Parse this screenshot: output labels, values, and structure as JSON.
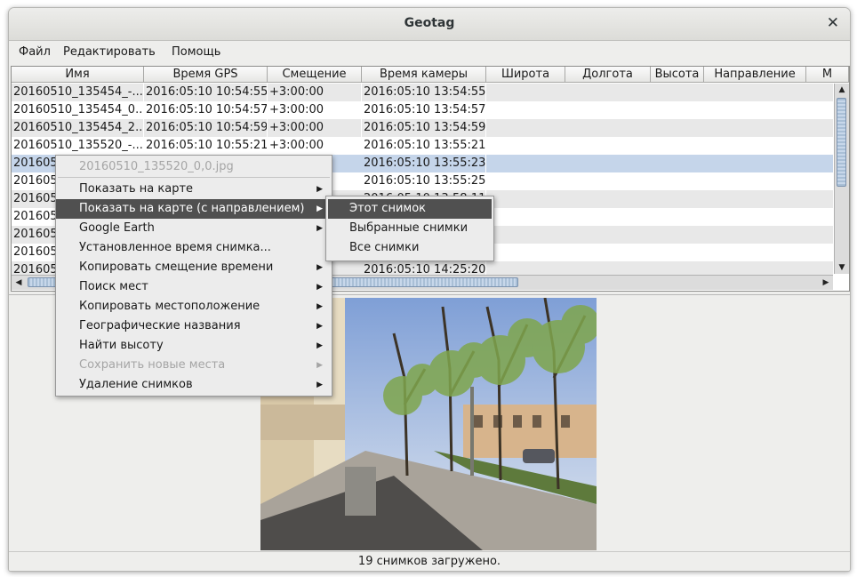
{
  "window": {
    "title": "Geotag"
  },
  "menu": [
    "Файл",
    "Редактировать",
    "Помощь"
  ],
  "table": {
    "columns": [
      "Имя",
      "Время GPS",
      "Смещение",
      "Время камеры",
      "Широта",
      "Долгота",
      "Высота",
      "Направление",
      "М"
    ],
    "rows": [
      [
        "20160510_135454_-...",
        "2016:05:10 10:54:55",
        "+3:00:00",
        "2016:05:10 13:54:55"
      ],
      [
        "20160510_135454_0...",
        "2016:05:10 10:54:57",
        "+3:00:00",
        "2016:05:10 13:54:57"
      ],
      [
        "20160510_135454_2...",
        "2016:05:10 10:54:59",
        "+3:00:00",
        "2016:05:10 13:54:59"
      ],
      [
        "20160510_135520_-...",
        "2016:05:10 10:55:21",
        "+3:00:00",
        "2016:05:10 13:55:21"
      ],
      [
        "2016051",
        "",
        "",
        "2016:05:10 13:55:23"
      ],
      [
        "2016051",
        "",
        "",
        "2016:05:10 13:55:25"
      ],
      [
        "2016051",
        "",
        "",
        "2016:05:10 13:58:11"
      ],
      [
        "2016051",
        "",
        "",
        ""
      ],
      [
        "2016051",
        "",
        "",
        ""
      ],
      [
        "2016051",
        "",
        "",
        ""
      ],
      [
        "2016051",
        "",
        "",
        "2016:05:10 14:25:20"
      ]
    ]
  },
  "context_menu": {
    "header": "20160510_135520_0,0.jpg",
    "items": [
      {
        "label": "Показать на карте",
        "submenu": true,
        "disabled": false
      },
      {
        "label": "Показать на карте (с направлением)",
        "submenu": true,
        "disabled": false,
        "active": true
      },
      {
        "label": "Google Earth",
        "submenu": true,
        "disabled": false
      },
      {
        "label": "Установленное время снимка...",
        "submenu": false,
        "disabled": false
      },
      {
        "label": "Копировать смещение времени",
        "submenu": true,
        "disabled": false
      },
      {
        "label": "Поиск мест",
        "submenu": true,
        "disabled": false
      },
      {
        "label": "Копировать местоположение",
        "submenu": true,
        "disabled": false
      },
      {
        "label": "Географические названия",
        "submenu": true,
        "disabled": false
      },
      {
        "label": "Найти высоту",
        "submenu": true,
        "disabled": false
      },
      {
        "label": "Сохранить новые места",
        "submenu": true,
        "disabled": true
      },
      {
        "label": "Удаление снимков",
        "submenu": true,
        "disabled": false
      }
    ],
    "submenu_items": [
      "Этот снимок",
      "Выбранные снимки",
      "Все снимки"
    ]
  },
  "status": "19 снимков загружено.",
  "icons": {
    "close": "close-icon",
    "submenu_arrow": "triangle-right-icon",
    "scroll_up": "triangle-up-icon",
    "scroll_down": "triangle-down-icon",
    "scroll_left": "triangle-left-icon",
    "scroll_right": "triangle-right-icon"
  },
  "colors": {
    "selection": "#c5d5ea",
    "menu_active": "#505050",
    "scroll_thumb": "#a9bfd6"
  }
}
